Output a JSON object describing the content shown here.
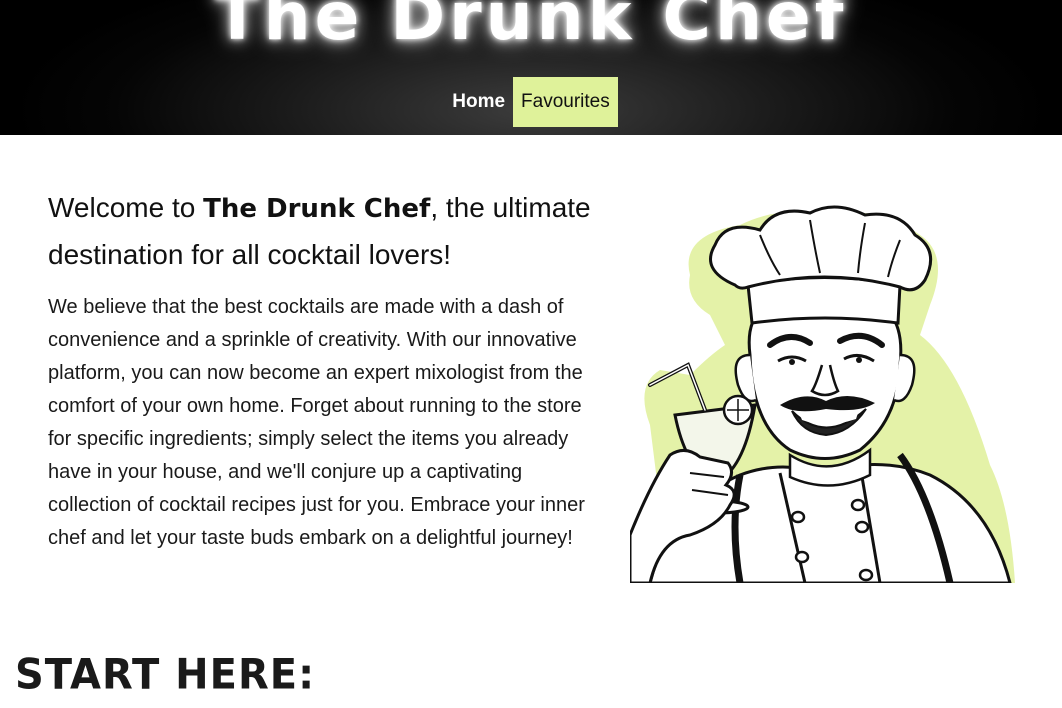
{
  "header": {
    "site_title": "The Drunk Chef",
    "nav": [
      {
        "label": "Home",
        "active": false
      },
      {
        "label": "Favourites",
        "active": true
      }
    ]
  },
  "intro": {
    "heading_prefix": "Welcome to ",
    "heading_brand": "The Drunk Chef",
    "heading_suffix": ", the ultimate destination for all cocktail lovers!",
    "body": "We believe that the best cocktails are made with a dash of convenience and a sprinkle of creativity. With our innovative platform, you can now become an expert mixologist from the comfort of your own home. Forget about running to the store for specific ingredients; simply select the items you already have in your house, and we'll conjure up a captivating collection of cocktail recipes just for you. Embrace your inner chef and let your taste buds embark on a delightful journey!"
  },
  "start": {
    "heading": "START HERE:"
  },
  "colors": {
    "accent": "#dff29a",
    "header_bg": "#000000"
  }
}
